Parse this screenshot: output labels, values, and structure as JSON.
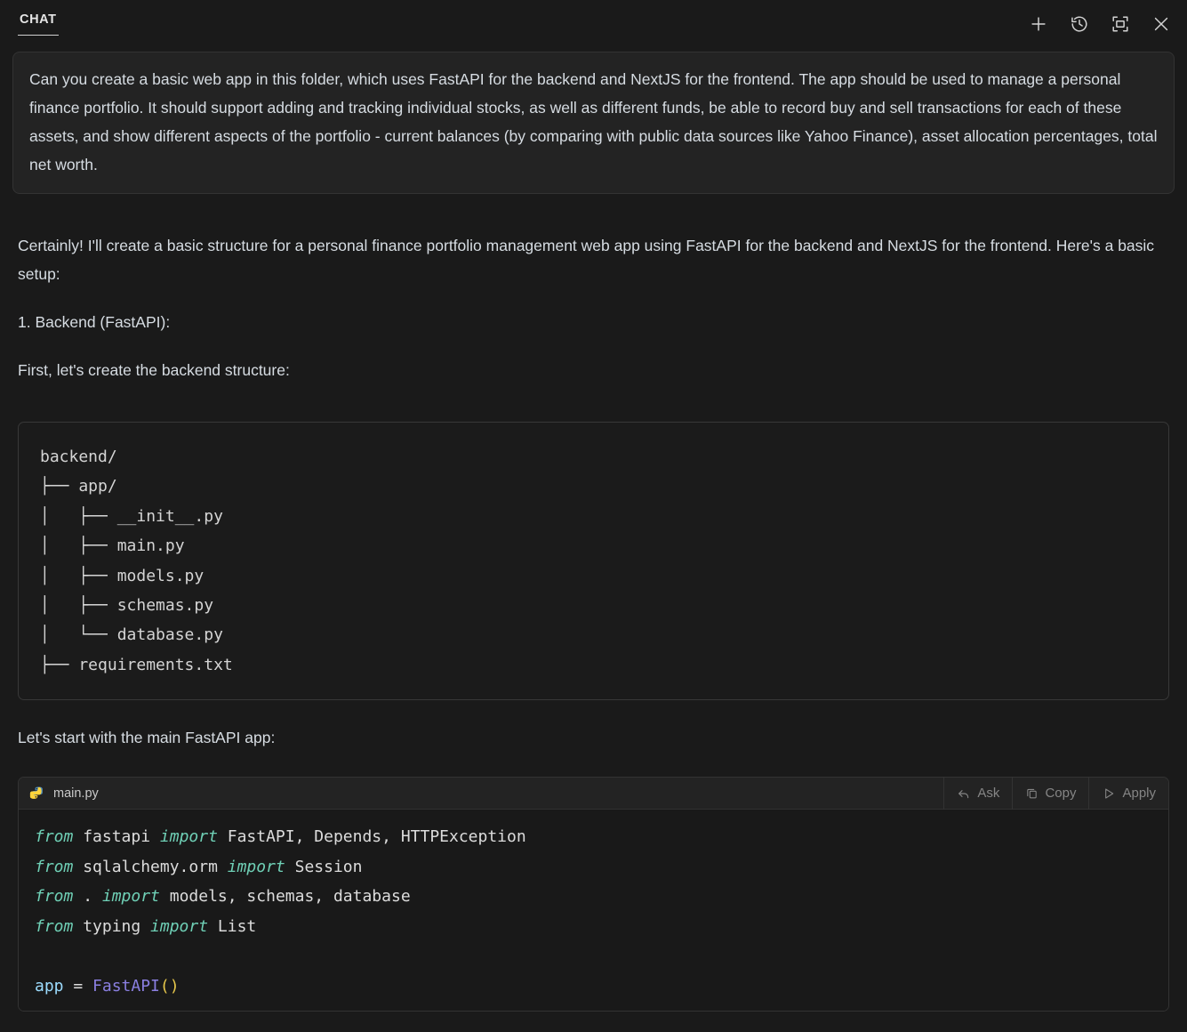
{
  "header": {
    "tab_label": "CHAT",
    "actions": [
      {
        "name": "new-chat-icon",
        "label": "New Chat"
      },
      {
        "name": "history-icon",
        "label": "History"
      },
      {
        "name": "maximize-icon",
        "label": "Maximize Panel"
      },
      {
        "name": "close-icon",
        "label": "Close"
      }
    ]
  },
  "user_message": {
    "text": "Can you create a basic web app in this folder, which uses FastAPI for the backend and NextJS for the frontend. The app should be used to manage a personal finance portfolio. It should support adding and tracking individual stocks, as well as different funds, be able to record buy and sell transactions for each of these assets, and show different aspects of the portfolio - current balances (by comparing with public data sources like Yahoo Finance), asset allocation percentages, total net worth."
  },
  "assistant_message": {
    "intro": "Certainly! I'll create a basic structure for a personal finance portfolio management web app using FastAPI for the backend and NextJS for the frontend. Here's a basic setup:",
    "step1": "1. Backend (FastAPI):",
    "first": "First, let's create the backend structure:",
    "lets_start": "Let's start with the main FastAPI app:"
  },
  "tree_block": {
    "content": "backend/\n├── app/\n│   ├── __init__.py\n│   ├── main.py\n│   ├── models.py\n│   ├── schemas.py\n│   └── database.py\n├── requirements.txt"
  },
  "code_block": {
    "filename": "main.py",
    "file_icon": "python-icon",
    "actions": [
      {
        "name": "ask-button",
        "label": "Ask",
        "icon": "reply-arrow-icon"
      },
      {
        "name": "copy-button",
        "label": "Copy",
        "icon": "copy-icon"
      },
      {
        "name": "apply-button",
        "label": "Apply",
        "icon": "play-triangle-icon"
      }
    ],
    "language": "python",
    "lines": [
      [
        {
          "t": "from ",
          "c": "k"
        },
        {
          "t": "fastapi ",
          "c": "n"
        },
        {
          "t": "import ",
          "c": "k"
        },
        {
          "t": "FastAPI, Depends, HTTPException",
          "c": "n"
        }
      ],
      [
        {
          "t": "from ",
          "c": "k"
        },
        {
          "t": "sqlalchemy.orm ",
          "c": "n"
        },
        {
          "t": "import ",
          "c": "k"
        },
        {
          "t": "Session",
          "c": "n"
        }
      ],
      [
        {
          "t": "from ",
          "c": "k"
        },
        {
          "t": ". ",
          "c": "n"
        },
        {
          "t": "import ",
          "c": "k"
        },
        {
          "t": "models, schemas, database",
          "c": "n"
        }
      ],
      [
        {
          "t": "from ",
          "c": "k"
        },
        {
          "t": "typing ",
          "c": "n"
        },
        {
          "t": "import ",
          "c": "k"
        },
        {
          "t": "List",
          "c": "n"
        }
      ],
      [
        {
          "t": "",
          "c": "n"
        }
      ],
      [
        {
          "t": "app",
          "c": "v"
        },
        {
          "t": " = ",
          "c": "o"
        },
        {
          "t": "FastAPI",
          "c": "c"
        },
        {
          "t": "()",
          "c": "p"
        }
      ]
    ]
  },
  "colors": {
    "page_background": "#1a1a1a",
    "bubble_background": "#232323",
    "code_background": "#191919",
    "text": "#d6dce2",
    "keyword": "#6fd0b6",
    "class_name": "#8a7fe0",
    "variable": "#9cdcfe",
    "punctuation": "#e7c84b",
    "muted": "#858585"
  }
}
